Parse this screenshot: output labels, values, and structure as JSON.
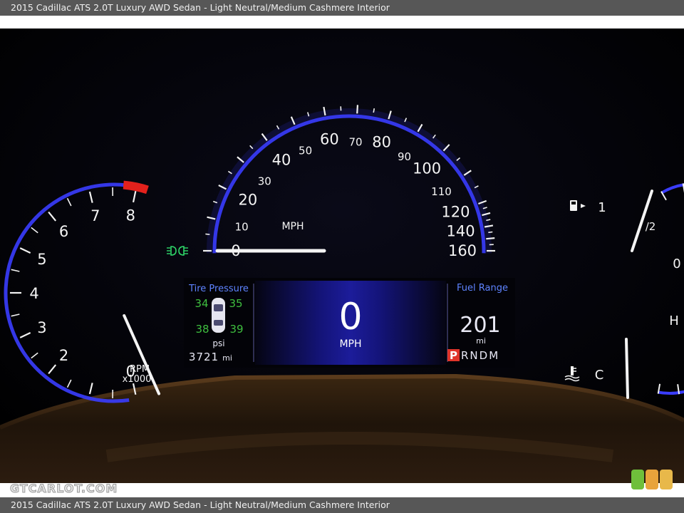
{
  "caption": "2015 Cadillac ATS 2.0T Luxury AWD Sedan - Light Neutral/Medium Cashmere Interior",
  "watermark": "GTCARLOT.COM",
  "cluster": {
    "speedometer": {
      "ticks": [
        "0",
        "10",
        "20",
        "30",
        "40",
        "50",
        "60",
        "70",
        "80",
        "90",
        "100",
        "110",
        "120",
        "140",
        "160"
      ],
      "unit": "MPH",
      "value": 0
    },
    "tachometer": {
      "ticks": [
        "0",
        "2",
        "3",
        "4",
        "5",
        "6",
        "7",
        "8"
      ],
      "unit": "RPM",
      "multiplier": "x1000",
      "value": 0
    },
    "fuel_gauge": {
      "full_label": "1",
      "half_label": "/2",
      "empty_label": "0",
      "level": 0.62
    },
    "temp_gauge": {
      "hot_label": "H",
      "cold_label": "C"
    },
    "tire_pressure": {
      "title": "Tire Pressure",
      "front_left": "34",
      "front_right": "35",
      "rear_left": "38",
      "rear_right": "39",
      "unit": "psi"
    },
    "odometer": {
      "value": "3721",
      "unit": "mi"
    },
    "digital_speed": {
      "value": "0",
      "unit": "MPH"
    },
    "fuel_range": {
      "title": "Fuel Range",
      "value": "201",
      "unit": "mi"
    },
    "gear": {
      "selected": "P",
      "others": "RNDM"
    }
  },
  "colors": {
    "accent_blue": "#3a3dff",
    "needle": "#f4f4f4",
    "tire_green": "#3fbf3f",
    "redline": "#e3211c",
    "gear_red": "#e0342a",
    "indicator_green": "#2fd86a"
  },
  "icons": [
    "headlight-indicator-icon",
    "fuel-pump-icon",
    "coolant-temperature-icon",
    "car-top-view-icon"
  ]
}
